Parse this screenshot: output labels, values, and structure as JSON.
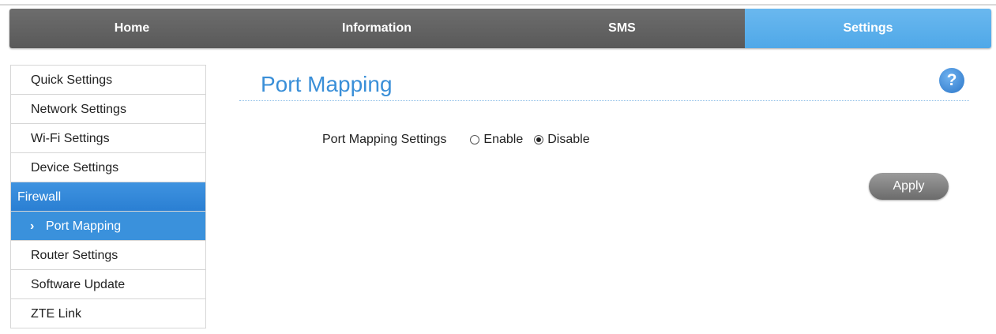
{
  "nav": {
    "tabs": [
      {
        "label": "Home"
      },
      {
        "label": "Information"
      },
      {
        "label": "SMS"
      },
      {
        "label": "Settings",
        "active": true
      }
    ],
    "active_color": "#5ab2ee",
    "inactive_color": "#626262"
  },
  "sidebar": {
    "items": [
      {
        "label": "Quick Settings"
      },
      {
        "label": "Network Settings"
      },
      {
        "label": "Wi-Fi Settings"
      },
      {
        "label": "Device Settings"
      },
      {
        "label": "Firewall",
        "active": true
      },
      {
        "label": "Port Mapping",
        "sub_active": true,
        "chevron": "›"
      },
      {
        "label": "Router Settings"
      },
      {
        "label": "Software Update"
      },
      {
        "label": "ZTE Link"
      }
    ],
    "active_color": "#3388d8"
  },
  "main": {
    "title": "Port Mapping",
    "help_icon": "?",
    "setting_label": "Port Mapping Settings",
    "options": [
      {
        "label": "Enable",
        "checked": false
      },
      {
        "label": "Disable",
        "checked": true
      }
    ],
    "apply_label": "Apply"
  }
}
